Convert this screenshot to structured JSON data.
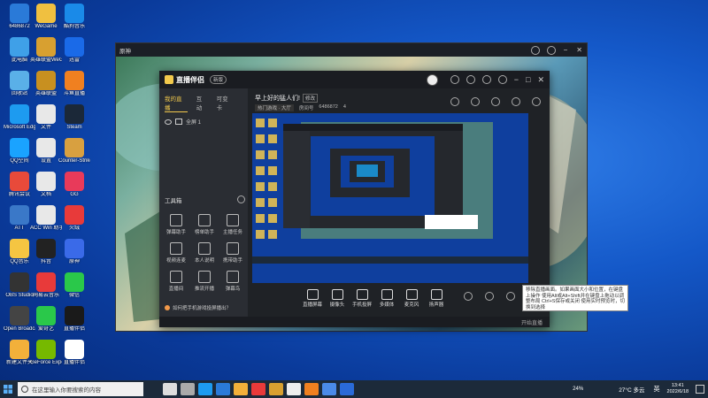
{
  "desktop": {
    "icons": [
      {
        "label": "6486872",
        "color": "#2a7ad8"
      },
      {
        "label": "此电脑",
        "color": "#3fa0e8"
      },
      {
        "label": "回收站",
        "color": "#5ab0e8"
      },
      {
        "label": "Microsoft Edge",
        "color": "#1d9bf0"
      },
      {
        "label": "QQ空间",
        "color": "#1aa3ff"
      },
      {
        "label": "腾讯会议",
        "color": "#e84a3a"
      },
      {
        "label": "ATT",
        "color": "#3a78c8"
      },
      {
        "label": "QQ音乐",
        "color": "#f5c542"
      },
      {
        "label": "OBS Studio",
        "color": "#333333"
      },
      {
        "label": "Open Broadcaster",
        "color": "#444444"
      },
      {
        "label": "新建文件夹",
        "color": "#f2b03a"
      },
      {
        "label": "WeGame",
        "color": "#f0c040"
      },
      {
        "label": "英雄联盟WeGame版",
        "color": "#d8a030"
      },
      {
        "label": "英雄联盟",
        "color": "#c89020"
      },
      {
        "label": "文件",
        "color": "#e8e8e8"
      },
      {
        "label": "设置",
        "color": "#e8e8e8"
      },
      {
        "label": "文档",
        "color": "#e8e8e8"
      },
      {
        "label": "ACC Win 助手",
        "color": "#e8e8e8"
      },
      {
        "label": "抖音",
        "color": "#222222"
      },
      {
        "label": "网易云音乐",
        "color": "#e83a3a"
      },
      {
        "label": "爱奇艺",
        "color": "#2ac84a"
      },
      {
        "label": "GeForce Experience",
        "color": "#76b900"
      },
      {
        "label": "酷狗音乐",
        "color": "#1a8ae8"
      },
      {
        "label": "迅雷",
        "color": "#1a6ae8"
      },
      {
        "label": "斗鱼直播",
        "color": "#f08020"
      },
      {
        "label": "Steam",
        "color": "#1b2838"
      },
      {
        "label": "Counter-Strike",
        "color": "#d8a040"
      },
      {
        "label": "GG",
        "color": "#e83a5a"
      },
      {
        "label": "火绒",
        "color": "#e83a3a"
      },
      {
        "label": "原神",
        "color": "#3a6ae8"
      },
      {
        "label": "微信",
        "color": "#2ac84a"
      },
      {
        "label": "直播伴侣",
        "color": "#1a1a1a"
      },
      {
        "label": "直播伴侣",
        "color": "#ffffff"
      }
    ]
  },
  "game_window": {
    "title": "原神"
  },
  "streamer": {
    "logo": "直播伴侣",
    "version_badge": "新版",
    "tabs": [
      "我的直播",
      "互动",
      "可变卡"
    ],
    "scene_item": "全屏 1",
    "stream_title": "早上好的猛人们!",
    "edit_label": "修改",
    "category": "热门游戏 · 大厅",
    "room_label": "房间号",
    "room_id": "6486872",
    "viewers": "4",
    "toolbox_title": "工具箱",
    "tools": [
      "弹幕助手",
      "榜单助手",
      "主播任务",
      "视频连麦",
      "本人说明",
      "携带助手",
      "直播间",
      "推流开播",
      "弹幕鸟"
    ],
    "controls": [
      "直播屏幕",
      "摄像头",
      "手机投屏",
      "多媒体",
      "麦克风",
      "扬声器"
    ],
    "hint": "如何把手机游戏投屏播出？",
    "status_right": "开始直播"
  },
  "tooltip": {
    "text": "移除直播画面。如果画面大小和位置，在键盘上操作 使用Alt或Alt+Shift并在键盘上拖动以调整布局 Ctrl+S保存或关闭 使用实时预览时，切换到选择"
  },
  "taskbar": {
    "search_placeholder": "在这里输入你要搜索的内容",
    "weather": "27°C 多云",
    "battery": "24%",
    "ime": "英",
    "time": "13:41",
    "date": "2022/6/18"
  }
}
